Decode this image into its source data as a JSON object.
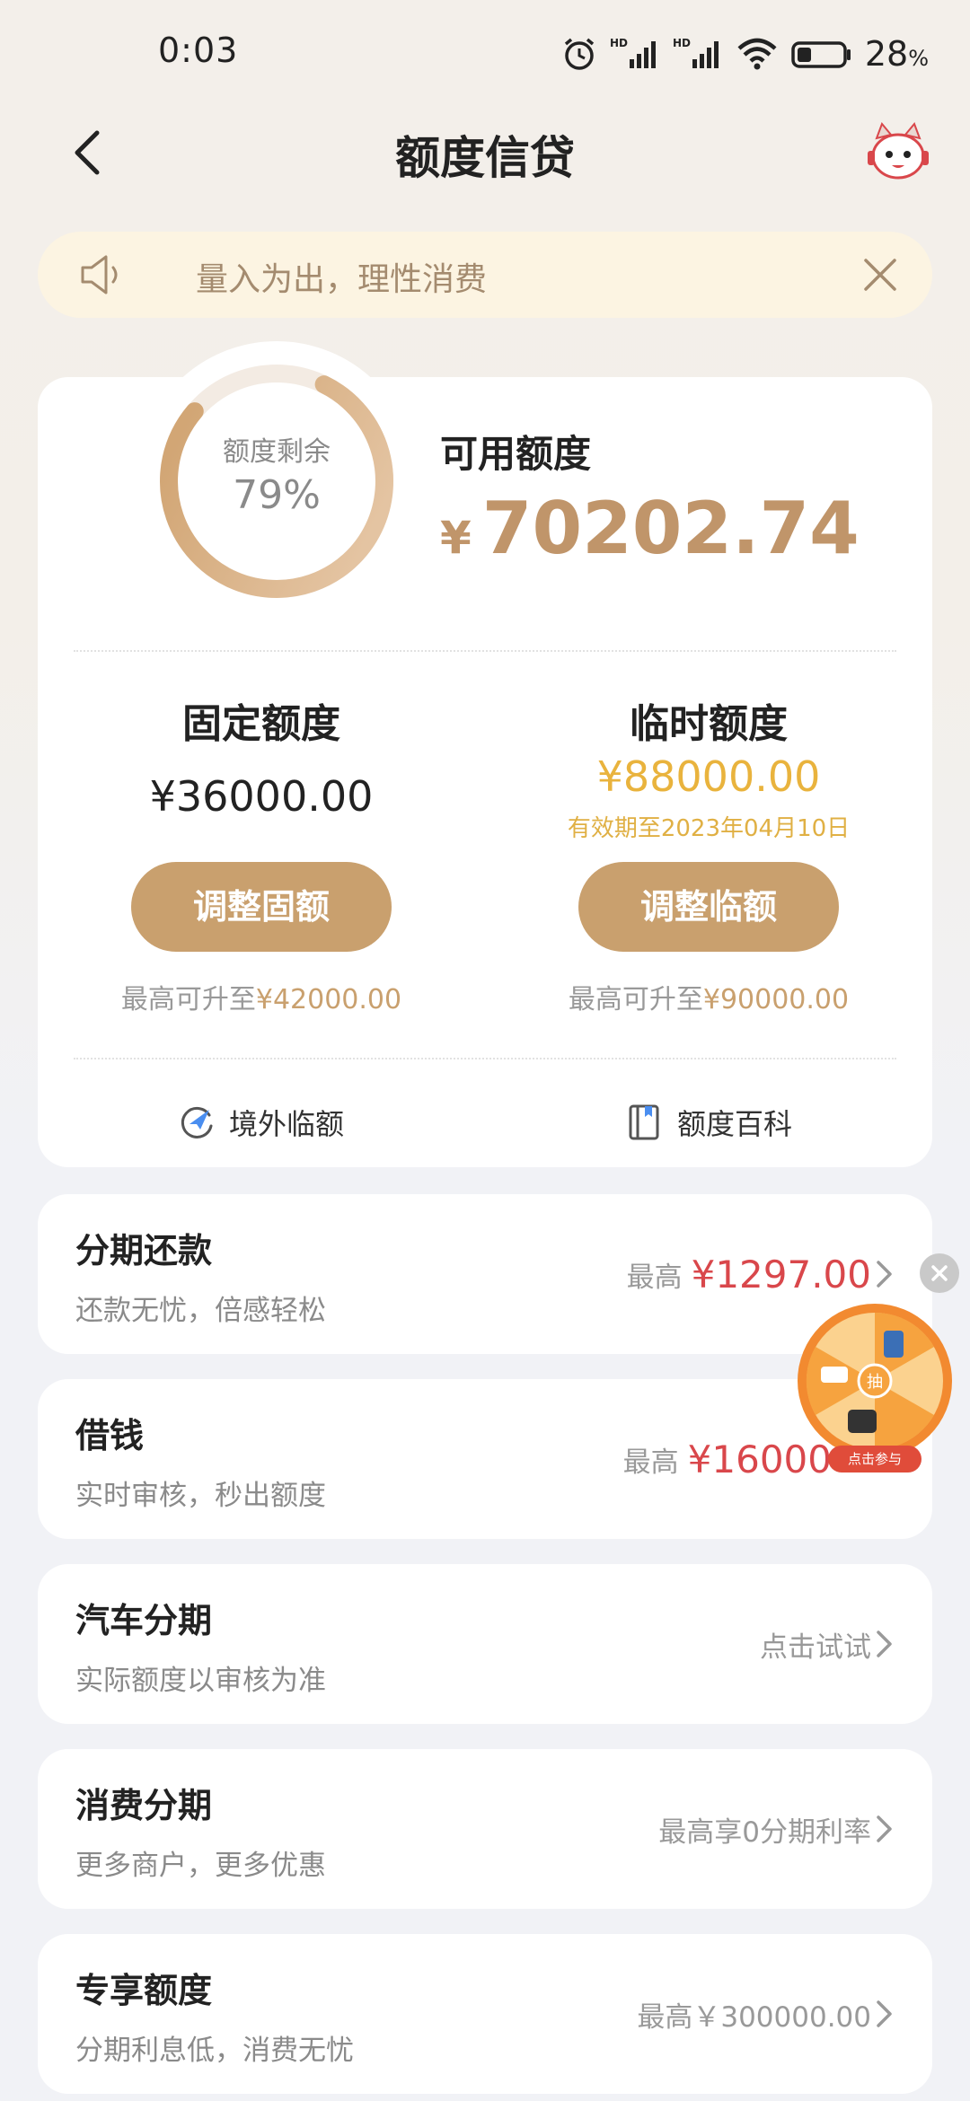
{
  "status_bar": {
    "time": "0:03",
    "battery": "28",
    "battery_unit": "%"
  },
  "header": {
    "title": "额度信贷"
  },
  "notice": {
    "text": "量入为出，理性消费"
  },
  "summary": {
    "ring_label": "额度剩余",
    "ring_percent_text": "79%",
    "ring_percent": 79,
    "available_label": "可用额度",
    "currency": "¥",
    "available_amount": "70202.74"
  },
  "fixed": {
    "title": "固定额度",
    "amount": "¥36000.00",
    "button": "调整固额",
    "max_prefix": "最高可升至",
    "max_amount": "¥42000.00"
  },
  "temporary": {
    "title": "临时额度",
    "amount": "¥88000.00",
    "valid": "有效期至2023年04月10日",
    "button": "调整临额",
    "max_prefix": "最高可升至",
    "max_amount": "¥90000.00"
  },
  "tools": [
    {
      "label": "境外临额",
      "icon": "plane-globe-icon"
    },
    {
      "label": "额度百科",
      "icon": "book-icon"
    }
  ],
  "list": [
    {
      "title": "分期还款",
      "subtitle": "还款无忧，倍感轻松",
      "prefix": "最高",
      "amount": "¥1297.00",
      "hint": ""
    },
    {
      "title": "借钱",
      "subtitle": "实时审核，秒出额度",
      "prefix": "最高",
      "amount": "¥16000",
      "hint": ""
    },
    {
      "title": "汽车分期",
      "subtitle": "实际额度以审核为准",
      "prefix": "",
      "amount": "",
      "hint": "点击试试"
    },
    {
      "title": "消费分期",
      "subtitle": "更多商户，更多优惠",
      "prefix": "",
      "amount": "",
      "hint": "最高享0分期利率"
    },
    {
      "title": "专享额度",
      "subtitle": "分期利息低，消费无忧",
      "prefix": "",
      "amount": "",
      "hint": "最高￥300000.00"
    }
  ],
  "float_widget": {
    "center": "抽",
    "tag": "点击参与"
  },
  "colors": {
    "accent": "#c9a06e",
    "gold": "#e9b33d",
    "red": "#d9474b"
  }
}
